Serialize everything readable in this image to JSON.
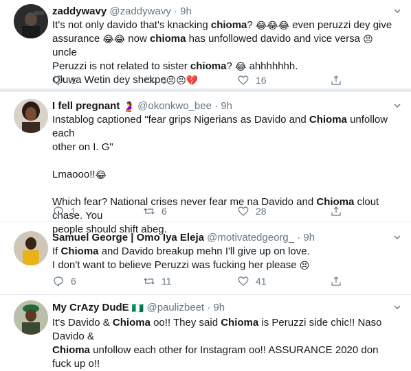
{
  "tweets": [
    {
      "name": "zaddywavy",
      "handle": "@zaddywavy",
      "time": "9h",
      "lines": [
        [
          {
            "t": "It's not only davido that's knacking "
          },
          {
            "b": "chioma"
          },
          {
            "t": "? "
          },
          {
            "e": "😂😂😂"
          },
          {
            "t": " even peruzzi dey give"
          }
        ],
        [
          {
            "t": "assurance "
          },
          {
            "e": "😂😂"
          },
          {
            "t": " now "
          },
          {
            "b": "chioma"
          },
          {
            "t": " has unfollowed davido and vice versa "
          },
          {
            "e": "😣"
          },
          {
            "t": " uncle"
          }
        ],
        [
          {
            "t": "Peruzzi is not related to sister "
          },
          {
            "b": "chioma"
          },
          {
            "t": "? "
          },
          {
            "e": "😂"
          },
          {
            "t": " ahhhhhhh."
          }
        ],
        [
          {
            "t": "Oluwa Wetin dey shekpe"
          },
          {
            "e": "😣😣💔"
          }
        ]
      ],
      "replies": "1",
      "retweets": "5",
      "likes": "16"
    },
    {
      "name": "I fell pregnant",
      "name_emoji": "🤰",
      "handle": "@okonkwo_bee",
      "time": "9h",
      "lines": [
        [
          {
            "t": "Instablog captioned \"fear grips Nigerians as Davido and "
          },
          {
            "b": "Chioma"
          },
          {
            "t": " unfollow each"
          }
        ],
        [
          {
            "t": "other on I. G\""
          }
        ],
        [],
        [
          {
            "t": "Lmaooo!!"
          },
          {
            "e": "😂"
          }
        ],
        [],
        [
          {
            "t": "Which fear? National crises never fear me na Davido and "
          },
          {
            "b": "Chioma"
          },
          {
            "t": " clout chase. You"
          }
        ],
        [
          {
            "t": "people should shift abeg."
          }
        ]
      ],
      "replies": "1",
      "retweets": "6",
      "likes": "28"
    },
    {
      "name": "Samuel George | Omo Iya Eleja",
      "handle": "@motivatedgeorg_",
      "time": "9h",
      "lines": [
        [
          {
            "t": "If "
          },
          {
            "b": "Chioma"
          },
          {
            "t": " and Davido breakup mehn I'll give up on love."
          }
        ],
        [
          {
            "t": "I don't want to believe Peruzzi was fucking her please "
          },
          {
            "e": "😣"
          }
        ]
      ],
      "replies": "6",
      "retweets": "11",
      "likes": "41"
    },
    {
      "name": "My CrAzy DudE",
      "name_emoji": "🇳🇬",
      "handle": "@paulizbeet",
      "time": "9h",
      "lines": [
        [
          {
            "t": "It's Davido & "
          },
          {
            "b": "Chioma"
          },
          {
            "t": " oo!! They said "
          },
          {
            "b": "Chioma"
          },
          {
            "t": " is Peruzzi side chic!! Naso Davido &"
          }
        ],
        [
          {
            "b": "Chioma"
          },
          {
            "t": " unfollow each other for Instagram oo!! ASSURANCE 2020 don fuck up o!!"
          }
        ]
      ]
    }
  ],
  "colors": {
    "text": "#14171a",
    "secondary": "#657786",
    "divider": "#e6ecf0"
  }
}
